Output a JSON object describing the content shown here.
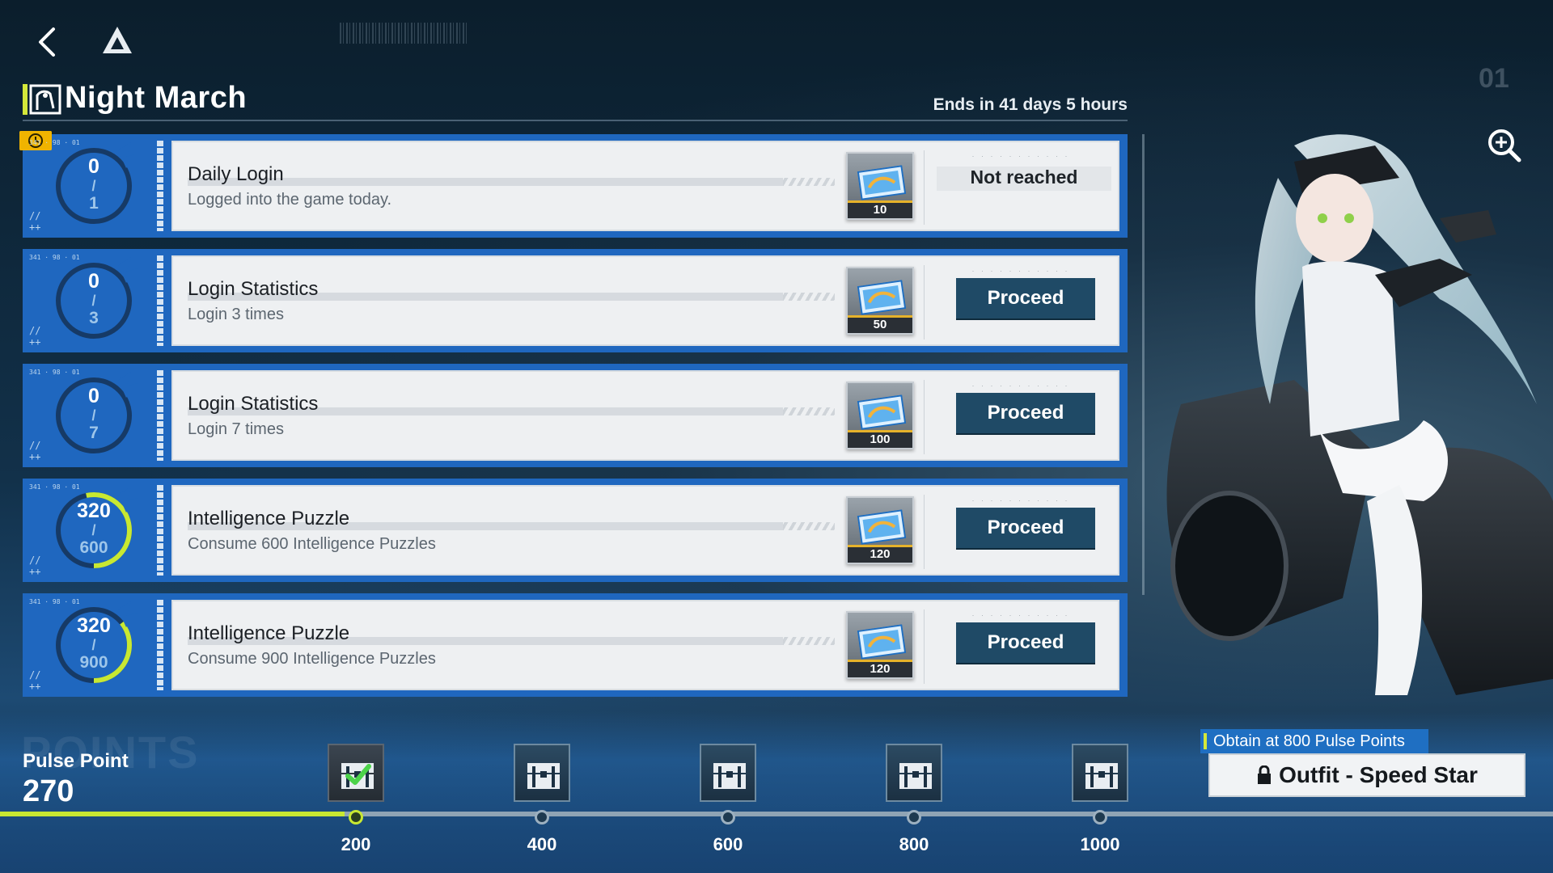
{
  "header": {
    "title": "Night March",
    "ends": "Ends in 41 days 5 hours"
  },
  "icons": {
    "back": "chevron-left-icon",
    "logo": "triangle-logo-icon",
    "zoom": "zoom-in-icon",
    "chest": "treasure-chest-icon",
    "lock": "lock-icon",
    "clock": "clock-icon"
  },
  "colors": {
    "accent": "#c8e832",
    "task_bg": "#1f67bf",
    "proceed_bg": "#1f4a66",
    "badge": "#f0b400"
  },
  "tasks": [
    {
      "name": "Daily Login",
      "desc": "Logged into the game today.",
      "current": "0",
      "total": "1",
      "progress": 0.0,
      "reward_qty": "10",
      "status": "Not reached",
      "action": ""
    },
    {
      "name": "Login Statistics",
      "desc": "Login 3 times",
      "current": "0",
      "total": "3",
      "progress": 0.0,
      "reward_qty": "50",
      "status": "",
      "action": "Proceed"
    },
    {
      "name": "Login Statistics",
      "desc": "Login 7 times",
      "current": "0",
      "total": "7",
      "progress": 0.0,
      "reward_qty": "100",
      "status": "",
      "action": "Proceed"
    },
    {
      "name": "Intelligence Puzzle",
      "desc": "Consume 600 Intelligence Puzzles",
      "current": "320",
      "total": "600",
      "progress": 0.533,
      "reward_qty": "120",
      "status": "",
      "action": "Proceed"
    },
    {
      "name": "Intelligence Puzzle",
      "desc": "Consume 900 Intelligence Puzzles",
      "current": "320",
      "total": "900",
      "progress": 0.356,
      "reward_qty": "120",
      "status": "",
      "action": "Proceed"
    }
  ],
  "points": {
    "ghost": "POINTS",
    "label": "Pulse Point",
    "value": "270",
    "fill": 0.222,
    "milestones": [
      {
        "label": "200",
        "claimed": true
      },
      {
        "label": "400",
        "claimed": false
      },
      {
        "label": "600",
        "claimed": false
      },
      {
        "label": "800",
        "claimed": false
      },
      {
        "label": "1000",
        "claimed": false
      }
    ]
  },
  "outfit": {
    "obtain": "Obtain at 800 Pulse Points",
    "name": "Outfit - Speed Star"
  }
}
